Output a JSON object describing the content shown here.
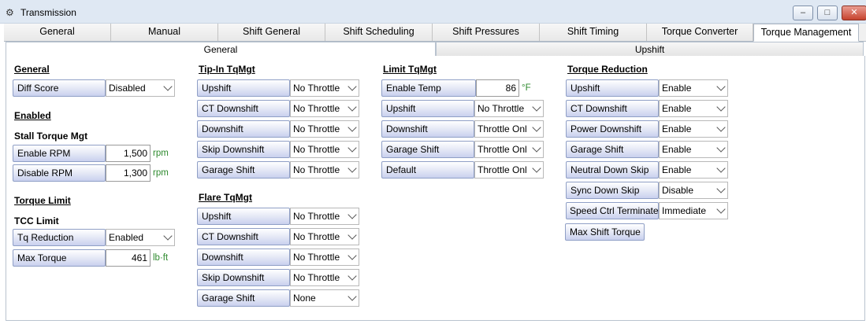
{
  "window": {
    "title": "Transmission"
  },
  "tabs": [
    "General",
    "Manual",
    "Shift General",
    "Shift Scheduling",
    "Shift Pressures",
    "Shift Timing",
    "Torque Converter",
    "Torque Management"
  ],
  "subtabs": [
    "General",
    "Upshift"
  ],
  "general": {
    "header": "General",
    "diff_score": {
      "label": "Diff Score",
      "value": "Disabled"
    },
    "enabled_header": "Enabled",
    "stall_header": "Stall Torque Mgt",
    "enable_rpm": {
      "label": "Enable RPM",
      "value": "1,500",
      "unit": "rpm"
    },
    "disable_rpm": {
      "label": "Disable RPM",
      "value": "1,300",
      "unit": "rpm"
    },
    "torque_limit_header": "Torque Limit",
    "tcc_limit_header": "TCC Limit",
    "tq_reduction": {
      "label": "Tq Reduction",
      "value": "Enabled"
    },
    "max_torque": {
      "label": "Max Torque",
      "value": "461",
      "unit": "lb·ft"
    }
  },
  "tipin": {
    "header": "Tip-In TqMgt",
    "rows": [
      {
        "label": "Upshift",
        "value": "No Throttle"
      },
      {
        "label": "CT Downshift",
        "value": "No Throttle"
      },
      {
        "label": "Downshift",
        "value": "No Throttle"
      },
      {
        "label": "Skip Downshift",
        "value": "No Throttle"
      },
      {
        "label": "Garage Shift",
        "value": "No Throttle"
      }
    ]
  },
  "flare": {
    "header": "Flare TqMgt",
    "rows": [
      {
        "label": "Upshift",
        "value": "No Throttle"
      },
      {
        "label": "CT Downshift",
        "value": "No Throttle"
      },
      {
        "label": "Downshift",
        "value": "No Throttle"
      },
      {
        "label": "Skip Downshift",
        "value": "No Throttle"
      },
      {
        "label": "Garage Shift",
        "value": "None"
      }
    ]
  },
  "limit": {
    "header": "Limit TqMgt",
    "enable_temp": {
      "label": "Enable Temp",
      "value": "86",
      "unit": "°F"
    },
    "rows": [
      {
        "label": "Upshift",
        "value": "No Throttle"
      },
      {
        "label": "Downshift",
        "value": "Throttle Onl"
      },
      {
        "label": "Garage Shift",
        "value": "Throttle Onl"
      },
      {
        "label": "Default",
        "value": "Throttle Onl"
      }
    ]
  },
  "reduction": {
    "header": "Torque Reduction",
    "rows": [
      {
        "label": "Upshift",
        "value": "Enable"
      },
      {
        "label": "CT Downshift",
        "value": "Enable"
      },
      {
        "label": "Power Downshift",
        "value": "Enable"
      },
      {
        "label": "Garage Shift",
        "value": "Enable"
      },
      {
        "label": "Neutral Down Skip",
        "value": "Enable"
      },
      {
        "label": "Sync Down Skip",
        "value": "Disable"
      },
      {
        "label": "Speed Ctrl Terminate",
        "value": "Immediate"
      }
    ],
    "max_shift_torque": "Max Shift Torque"
  }
}
